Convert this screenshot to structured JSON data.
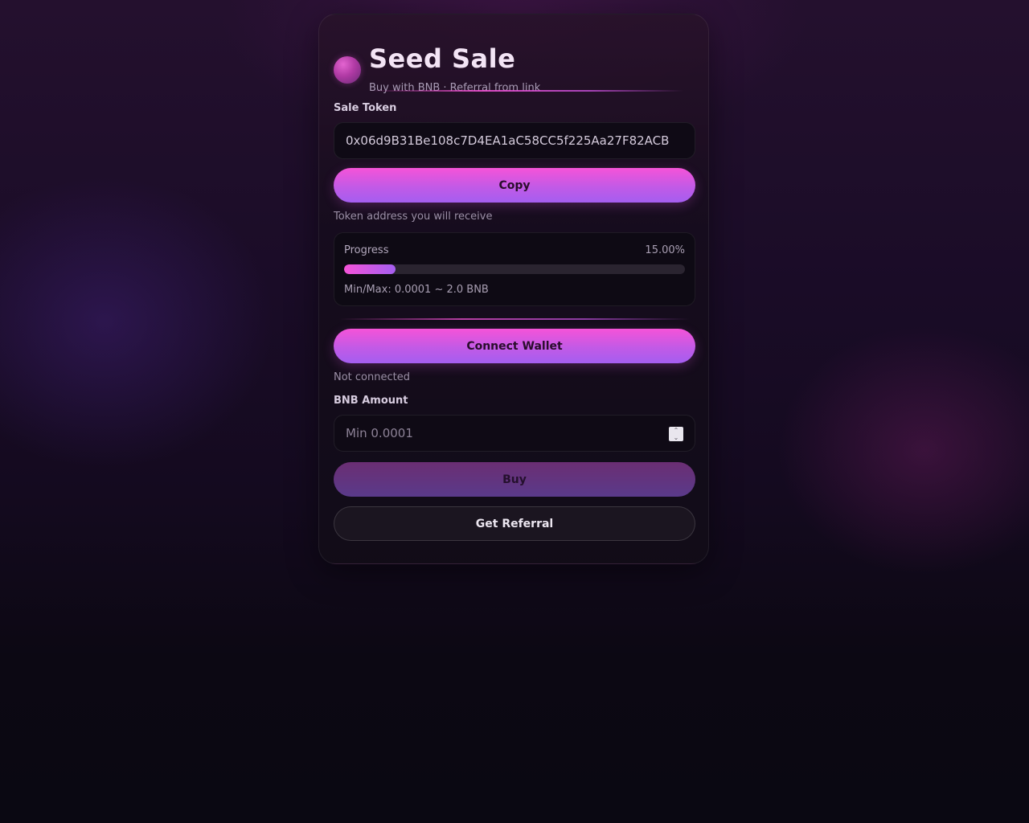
{
  "header": {
    "title": "Seed Sale",
    "subtitle": "Buy with BNB · Referral from link",
    "logo_icon": "gradient-orb-icon"
  },
  "sale_token": {
    "label": "Sale Token",
    "address": "0x06d9B31Be108c7D4EA1aC58CC5f225Aa27F82ACB",
    "copy_label": "Copy",
    "hint": "Token address you will receive"
  },
  "progress": {
    "label": "Progress",
    "value_text": "15.00%",
    "fraction": 0.15,
    "minmax": "Min/Max: 0.0001 ~ 2.0 BNB"
  },
  "wallet": {
    "connect_label": "Connect Wallet",
    "status": "Not connected"
  },
  "amount": {
    "label": "BNB Amount",
    "placeholder": "Min 0.0001",
    "value": ""
  },
  "actions": {
    "buy_label": "Buy",
    "referral_label": "Get Referral"
  },
  "colors": {
    "accent_pink": "#f553d8",
    "accent_purple": "#a45ef0",
    "card_bg": "#160d1d",
    "page_bg": "#0a0812"
  }
}
